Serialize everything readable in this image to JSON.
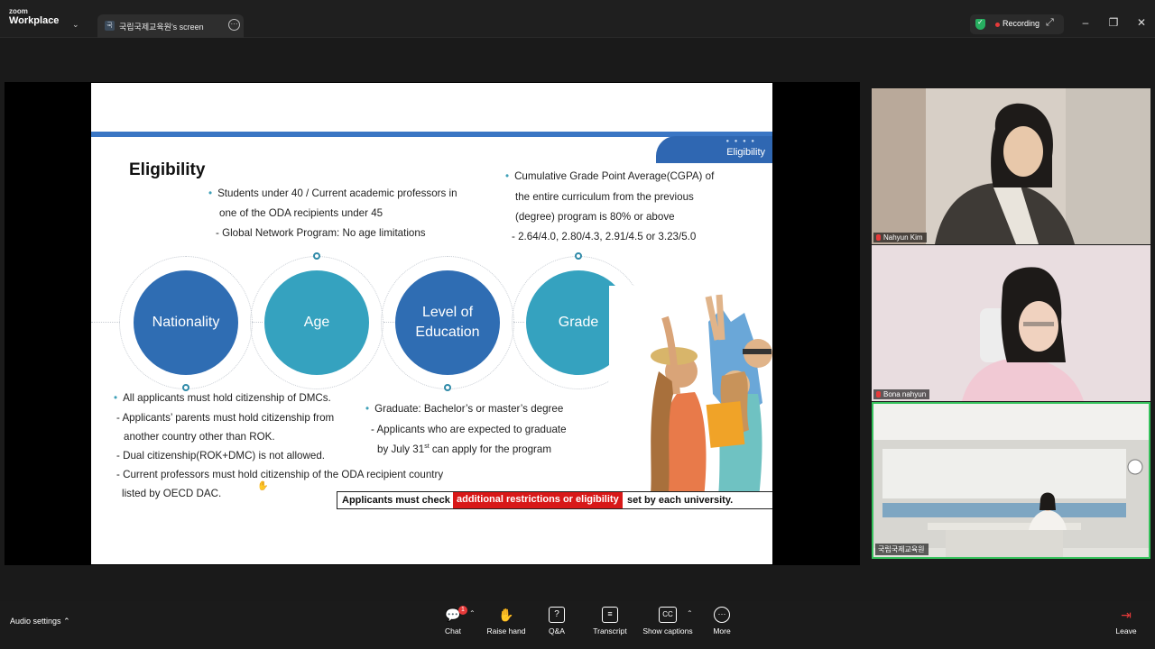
{
  "app": {
    "logo_top": "zoom",
    "logo_bottom": "Workplace",
    "tab_icon_text": "국",
    "tab_label": "국립국제교육원's screen",
    "recording_label": "Recording",
    "colors": {
      "accent": "#2f67b2",
      "recording": "#e63a3a",
      "secure": "#27ae60"
    }
  },
  "slide": {
    "corner_label": "Eligibility",
    "title": "Eligibility",
    "age_lines": [
      "Students under 40 / Current academic professors in",
      "one of the ODA recipients under 45",
      "- Global Network Program: No age limitations"
    ],
    "grade_lines": [
      "Cumulative Grade Point Average(CGPA) of",
      "the entire curriculum from the previous",
      "(degree) program is 80% or above",
      "- 2.64/4.0, 2.80/4.3, 2.91/4.5 or 3.23/5.0"
    ],
    "circles": [
      {
        "label": "Nationality",
        "color": "#2f6db3"
      },
      {
        "label": "Age",
        "color": "#35a2bf"
      },
      {
        "label_1": "Level of",
        "label_2": "Education",
        "color": "#2f6db3"
      },
      {
        "label": "Grade",
        "color": "#35a2bf"
      }
    ],
    "nationality_lines": [
      "All applicants must hold citizenship of DMCs.",
      "- Applicants’ parents must hold citizenship from",
      "another country other than ROK.",
      "- Dual citizenship(ROK+DMC) is not allowed.",
      "- Current professors must hold citizenship of the ODA recipient country",
      "listed by OECD DAC."
    ],
    "education_lines": [
      "Graduate: Bachelor’s or master’s degree",
      "- Applicants who are expected to graduate",
      "by July 31",
      "st",
      " can apply for the program"
    ],
    "banner": {
      "before": "Applicants must check",
      "highlight": "additional restrictions or eligibility",
      "after": "set by each university."
    }
  },
  "participants": [
    {
      "name": "Nahyun Kim"
    },
    {
      "name": "Bona nahyun"
    },
    {
      "name": "국립국제교육원"
    }
  ],
  "toolbar": {
    "audio_settings": "Audio settings",
    "chat_badge": "1",
    "items": [
      "Chat",
      "Raise hand",
      "Q&A",
      "Transcript",
      "Show captions",
      "More"
    ],
    "leave": "Leave"
  }
}
